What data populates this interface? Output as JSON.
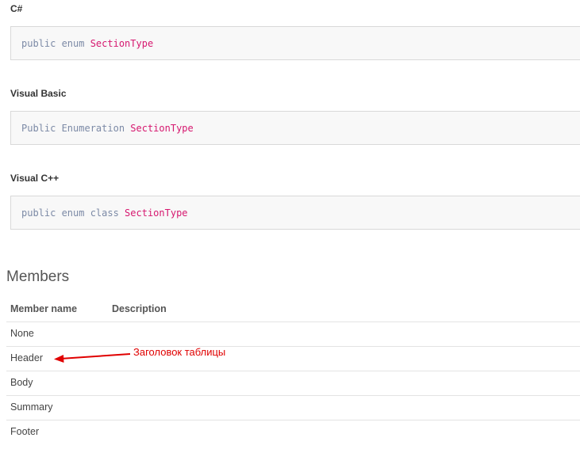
{
  "syntax": [
    {
      "language": "C#",
      "tokens": [
        {
          "t": "public enum ",
          "k": "kw"
        },
        {
          "t": "SectionType",
          "k": "ty"
        }
      ]
    },
    {
      "language": "Visual Basic",
      "tokens": [
        {
          "t": "Public Enumeration ",
          "k": "kw"
        },
        {
          "t": "SectionType",
          "k": "ty"
        }
      ]
    },
    {
      "language": "Visual C++",
      "tokens": [
        {
          "t": "public enum class ",
          "k": "kw"
        },
        {
          "t": "SectionType",
          "k": "ty"
        }
      ]
    }
  ],
  "members": {
    "title": "Members",
    "col_name": "Member name",
    "col_description": "Description",
    "rows": [
      "None",
      "Header",
      "Body",
      "Summary",
      "Footer"
    ]
  },
  "annotation": {
    "text": "Заголовок таблицы",
    "color": "#e00000"
  },
  "colors": {
    "keyword": "#7c8aa6",
    "type": "#d6186f"
  }
}
